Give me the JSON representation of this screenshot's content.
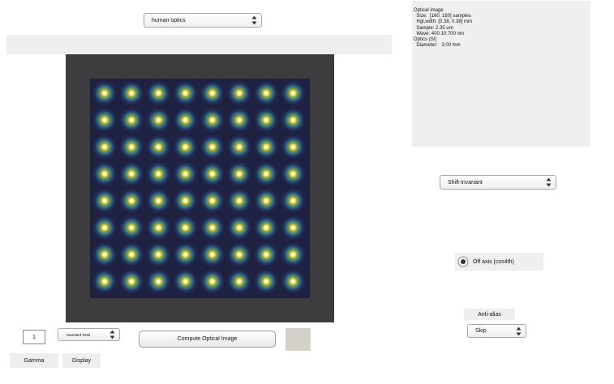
{
  "optics_selector": {
    "value": "human optics"
  },
  "info": {
    "lines": [
      "Optical image",
      "  Size:  [160, 160] samples",
      "  Hgt,wdth: [0.38, 0.38] mm",
      "  Sample: 2.35 um",
      "  Wave: 400:10:700 nm",
      "Optics (SI)",
      "  Diameter:   3.00 mm"
    ]
  },
  "model_selector": {
    "value": "Shift-invariant"
  },
  "off_axis": {
    "label": "Off axis (cos4th)",
    "checked": true
  },
  "anti_alias": {
    "label": "Anti-alias",
    "selector_value": "Skip"
  },
  "gamma": {
    "value": "1",
    "label": "Gamma"
  },
  "display": {
    "selector_value": "Standard RGB",
    "label": "Display"
  },
  "compute_button": {
    "label": "Compute Optical Image"
  },
  "colors": {
    "image_background": "#3d3d40",
    "psf_core": "#fff27a",
    "psf_ring": "#3a7f7a"
  },
  "image": {
    "grid_rows": 8,
    "grid_cols": 8
  }
}
